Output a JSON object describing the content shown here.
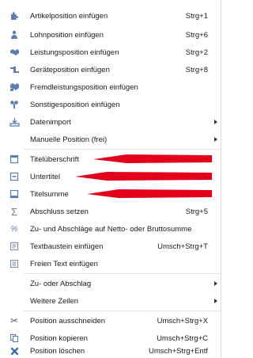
{
  "menu": {
    "items": [
      {
        "id": "artikelposition",
        "label": "Artikelposition einfügen",
        "shortcut": "Strg+1",
        "icon": "puzzle-icon"
      },
      {
        "id": "lohnposition",
        "label": "Lohnposition einfügen",
        "shortcut": "Strg+6",
        "icon": "worker-icon"
      },
      {
        "id": "leistungsposition",
        "label": "Leistungsposition einfügen",
        "shortcut": "Strg+2",
        "icon": "handshake-icon"
      },
      {
        "id": "geraeteposition",
        "label": "Geräteposition einfügen",
        "shortcut": "Strg+8",
        "icon": "equipment-icon"
      },
      {
        "id": "fremdleistungsposition",
        "label": "Fremdleistungsposition einfügen",
        "shortcut": "",
        "icon": "external-service-icon"
      },
      {
        "id": "sonstigesposition",
        "label": "Sonstigesposition einfügen",
        "shortcut": "",
        "icon": "misc-position-icon"
      },
      {
        "id": "datenimport",
        "label": "Datenimport",
        "shortcut": "",
        "icon": "import-icon",
        "submenu": true
      },
      {
        "id": "manuelle-position",
        "label": "Manuelle Position (frei)",
        "shortcut": "",
        "icon": "",
        "submenu": true
      },
      {
        "id": "titelueberschrift",
        "label": "Titelüberschrift",
        "shortcut": "",
        "icon": "title-heading-icon"
      },
      {
        "id": "untertitel",
        "label": "Untertitel",
        "shortcut": "",
        "icon": "subtitle-icon"
      },
      {
        "id": "titelsumme",
        "label": "Titelsumme",
        "shortcut": "",
        "icon": "title-sum-icon"
      },
      {
        "id": "abschluss",
        "label": "Abschluss setzen",
        "shortcut": "Strg+5",
        "icon": "sigma-icon"
      },
      {
        "id": "zu-abschlaege-netto",
        "label": "Zu- und Abschläge auf Netto- oder Bruttosumme",
        "shortcut": "",
        "icon": "percent-icon"
      },
      {
        "id": "textbaustein",
        "label": "Textbaustein einfügen",
        "shortcut": "Umsch+Strg+T",
        "icon": "text-block-icon"
      },
      {
        "id": "freier-text",
        "label": "Freien Text einfügen",
        "shortcut": "",
        "icon": "free-text-icon"
      },
      {
        "id": "zu-abschlag",
        "label": "Zu- oder Abschlag",
        "shortcut": "",
        "icon": "",
        "submenu": true
      },
      {
        "id": "weitere-zeilen",
        "label": "Weitere Zeilen",
        "shortcut": "",
        "icon": "",
        "submenu": true
      },
      {
        "id": "ausschneiden",
        "label": "Position ausschneiden",
        "shortcut": "Umsch+Strg+X",
        "icon": "scissors-icon"
      },
      {
        "id": "kopieren",
        "label": "Position kopieren",
        "shortcut": "Umsch+Strg+C",
        "icon": "copy-icon"
      },
      {
        "id": "loeschen",
        "label": "Position löschen",
        "shortcut": "Umsch+Strg+Entf",
        "icon": "delete-icon"
      }
    ]
  },
  "colors": {
    "icon_blue": "#5b7fb0",
    "annotation_red": "#e3001b",
    "delete_blue": "#3a6fb5"
  }
}
